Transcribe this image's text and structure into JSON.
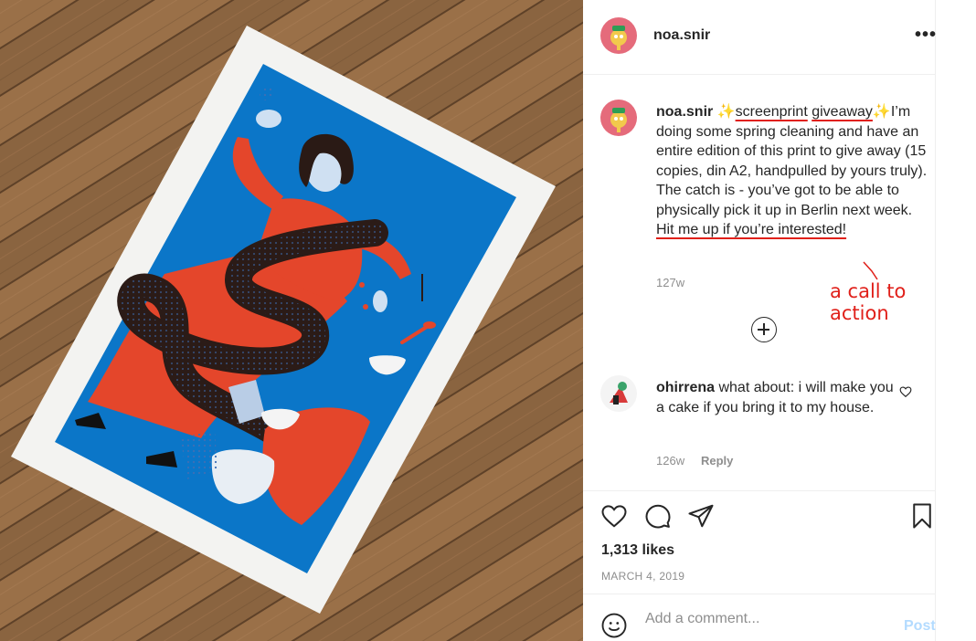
{
  "post": {
    "username": "noa.snir",
    "more_label": "•••"
  },
  "caption": {
    "username": "noa.snir",
    "sparkle": "✨",
    "highlight_1": "screenprint",
    "highlight_2": "giveaway",
    "sparkle_2": "✨",
    "body": "I’m doing some spring cleaning and have an entire edition of this print to give away (15 copies, din A2, handpulled by yours truly). The catch is - you’ve got to be able to physically pick it up in Berlin next week. ",
    "cta": "Hit me up if you’re interested!",
    "timestamp": "127w"
  },
  "annotation": {
    "text": "a call to action",
    "color": "#e0201a"
  },
  "load_more": {
    "icon": "plus-circle-icon"
  },
  "comment": {
    "username": "ohirrena",
    "text": "what about: i will make you a cake if you bring it to my house.",
    "timestamp": "126w",
    "reply_label": "Reply"
  },
  "actions": {
    "likes": "1,313 likes",
    "date": "MARCH 4, 2019",
    "icons": [
      "heart-icon",
      "comment-bubble-icon",
      "paper-plane-icon",
      "bookmark-icon"
    ]
  },
  "add_comment": {
    "placeholder": "Add a comment...",
    "post_label": "Post",
    "post_color": "#b3dbff"
  }
}
